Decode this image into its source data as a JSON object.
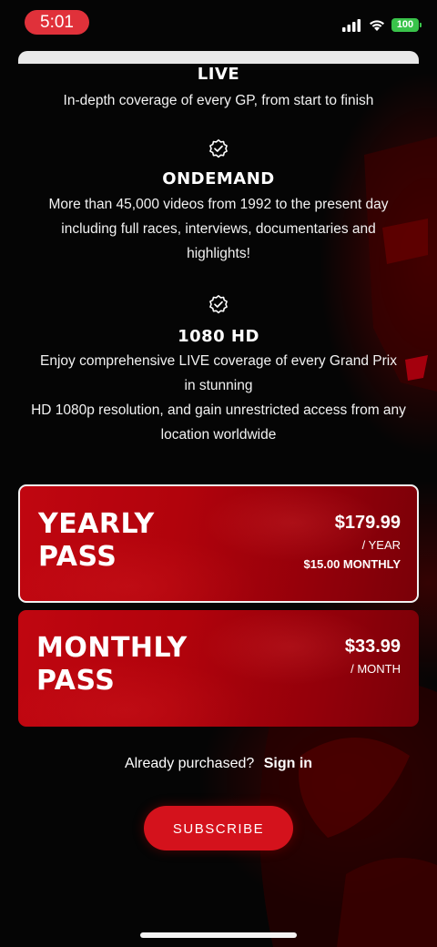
{
  "status_bar": {
    "time": "5:01",
    "battery": "100",
    "icons": [
      "signal-icon",
      "wifi-icon",
      "battery-icon"
    ]
  },
  "features": [
    {
      "title": "LIVE",
      "lines": [
        "In-depth coverage of every GP, from start to finish"
      ],
      "icon": "none"
    },
    {
      "title": "ONDEMAND",
      "lines": [
        "More than 45,000 videos from 1992 to the present day",
        "including full races, interviews, documentaries and",
        "highlights!"
      ],
      "icon": "verified-badge-icon"
    },
    {
      "title": "1080 HD",
      "lines": [
        "Enjoy comprehensive LIVE coverage of every Grand Prix",
        "in stunning",
        "HD 1080p resolution, and gain unrestricted access from any",
        "location worldwide"
      ],
      "icon": "verified-badge-icon"
    }
  ],
  "plans": [
    {
      "name_line1": "YEARLY",
      "name_line2": "PASS",
      "price": "$179.99",
      "period": "/ YEAR",
      "monthly": "$15.00 MONTHLY",
      "selected": true
    },
    {
      "name_line1": "MONTHLY",
      "name_line2": "PASS",
      "price": "$33.99",
      "period": "/ MONTH",
      "selected": false
    }
  ],
  "signin": {
    "prompt": "Already purchased?",
    "link": "Sign in"
  },
  "subscribe_label": "SUBSCRIBE",
  "colors": {
    "accent": "#d4121c",
    "plan_red": "#b1030c",
    "time_pill": "#e0313a",
    "battery": "#39c34a",
    "background": "#050505"
  }
}
